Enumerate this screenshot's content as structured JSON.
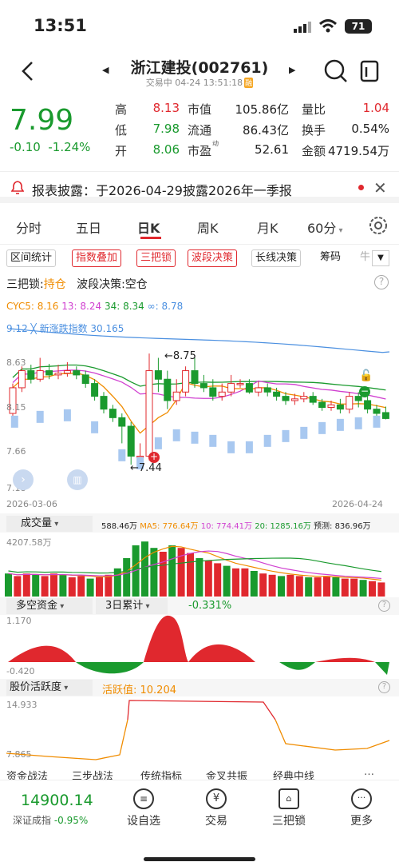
{
  "status_bar": {
    "time": "13:51",
    "battery": "71"
  },
  "header": {
    "title": "浙江建投(002761)",
    "subtitle": "交易中 04-24 13:51:18",
    "rz_badge": "融"
  },
  "quote": {
    "price": "7.99",
    "change": "-0.10",
    "change_pct": "-1.24%",
    "rows": [
      [
        {
          "label": "高",
          "value": "8.13",
          "color": "red"
        },
        {
          "label": "市值",
          "value": "105.86亿",
          "color": "black"
        },
        {
          "label": "量比",
          "value": "1.04",
          "color": "red"
        }
      ],
      [
        {
          "label": "低",
          "value": "7.98",
          "color": "green"
        },
        {
          "label": "流通",
          "value": "86.43亿",
          "color": "black"
        },
        {
          "label": "换手",
          "value": "0.54%",
          "color": "black"
        }
      ],
      [
        {
          "label": "开",
          "value": "8.06",
          "color": "green"
        },
        {
          "label": "市盈",
          "sup": "动",
          "value": "52.61",
          "color": "black"
        },
        {
          "label": "金额",
          "value": "4719.54万",
          "color": "black"
        }
      ]
    ]
  },
  "notice": {
    "text": "报表披露：于2026-04-29披露2026年一季报"
  },
  "tabs": [
    {
      "label": "分时",
      "active": false
    },
    {
      "label": "五日",
      "active": false
    },
    {
      "label": "日K",
      "active": true
    },
    {
      "label": "周K",
      "active": false
    },
    {
      "label": "月K",
      "active": false
    },
    {
      "label": "60分",
      "active": false
    }
  ],
  "chips": [
    {
      "label": "区间统计",
      "red": false
    },
    {
      "label": "指数叠加",
      "red": true
    },
    {
      "label": "三把锁",
      "red": true
    },
    {
      "label": "波段决策",
      "red": true
    },
    {
      "label": "长线决策",
      "red": false
    },
    {
      "label": "筹码",
      "red": false
    },
    {
      "label": "牛",
      "red": false
    }
  ],
  "strategy": {
    "lock_label": "三把锁:",
    "lock_value": "持仓",
    "band_label": "波段决策:",
    "band_value": "空仓"
  },
  "cyc": {
    "c5": "CYC5: 8.16",
    "c13": "13: 8.24",
    "c34": "34: 8.34",
    "cinf": "∞: 8.78"
  },
  "kline": {
    "index_label": "9.12  ╳ 新涨跌指数  30.165",
    "y_labels": [
      "8.63",
      "8.15",
      "7.66",
      "7.18"
    ],
    "high_mark": "←8.75",
    "low_mark": "←7.44",
    "date_start": "2026-03-06",
    "date_end": "2026-04-24"
  },
  "volume": {
    "title": "成交量",
    "current": "588.46万",
    "ma5": "MA5: 776.64万",
    "ma10": "10: 774.41万",
    "ma20": "20: 1285.16万",
    "forecast": "预测: 836.96万",
    "top": "4207.58万"
  },
  "fund": {
    "title": "多空资金",
    "period": "3日累计",
    "value": "-0.331%",
    "top": "1.170",
    "bottom": "-0.420"
  },
  "activity": {
    "title": "股价活跃度",
    "value": "活跃值: 10.204",
    "top": "14.933",
    "bottom": "7.865"
  },
  "strategy_tabs": [
    "资金战法",
    "三步战法",
    "传统指标",
    "金叉共振",
    "经典中线"
  ],
  "bottom": {
    "index_value": "14900.14",
    "index_name": "深证成指",
    "index_change": "-0.95%",
    "nav": [
      {
        "label": "设自选",
        "icon": "list-icon"
      },
      {
        "label": "交易",
        "icon": "yen-icon"
      },
      {
        "label": "三把锁",
        "icon": "locks-icon"
      },
      {
        "label": "更多",
        "icon": "more-icon"
      }
    ]
  },
  "colors": {
    "up": "#e0282e",
    "down": "#1a9a2e",
    "blue": "#4a8fe0"
  }
}
